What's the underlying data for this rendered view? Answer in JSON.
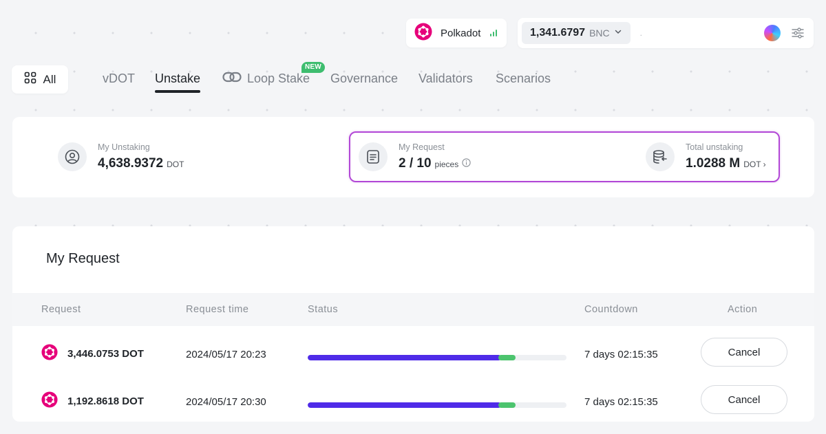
{
  "topbar": {
    "chain": {
      "name": "Polkadot",
      "icon": "polkadot-logo-icon"
    },
    "balance": {
      "value": "1,341.6797",
      "unit": "BNC"
    },
    "address": ".",
    "colors": {
      "polkadot": "#e6007a",
      "signal": "#3ebd6f"
    }
  },
  "nav": {
    "all_label": "All",
    "tabs": [
      {
        "label": "vDOT",
        "active": false
      },
      {
        "label": "Unstake",
        "active": true
      },
      {
        "label": "Loop Stake",
        "active": false,
        "badge": "NEW"
      },
      {
        "label": "Governance",
        "active": false
      },
      {
        "label": "Validators",
        "active": false
      },
      {
        "label": "Scenarios",
        "active": false
      }
    ]
  },
  "stats": {
    "my_unstaking": {
      "label": "My Unstaking",
      "value": "4,638.9372",
      "unit": "DOT",
      "icon": "user-circle-icon"
    },
    "my_request": {
      "label": "My Request",
      "value": "2 / 10",
      "unit": "pieces",
      "icon": "document-icon"
    },
    "total_unstaking": {
      "label": "Total unstaking",
      "value": "1.0288 M",
      "unit": "DOT ›",
      "icon": "coins-stack-icon"
    },
    "highlight_color": "#b247d6"
  },
  "requests": {
    "title": "My Request",
    "columns": [
      "Request",
      "Request time",
      "Status",
      "Countdown",
      "Action"
    ],
    "rows": [
      {
        "amount": "3,446.0753 DOT",
        "time": "2024/05/17 20:23",
        "countdown": "7 days 02:15:35",
        "action": "Cancel",
        "progress_primary": 0.747,
        "progress_secondary": 0.056
      },
      {
        "amount": "1,192.8618 DOT",
        "time": "2024/05/17 20:30",
        "countdown": "7 days 02:15:35",
        "action": "Cancel",
        "progress_primary": 0.747,
        "progress_secondary": 0.056
      }
    ],
    "colors": {
      "primary": "#4f2be8",
      "secondary": "#4cc46e",
      "track": "#eef0f3"
    }
  }
}
